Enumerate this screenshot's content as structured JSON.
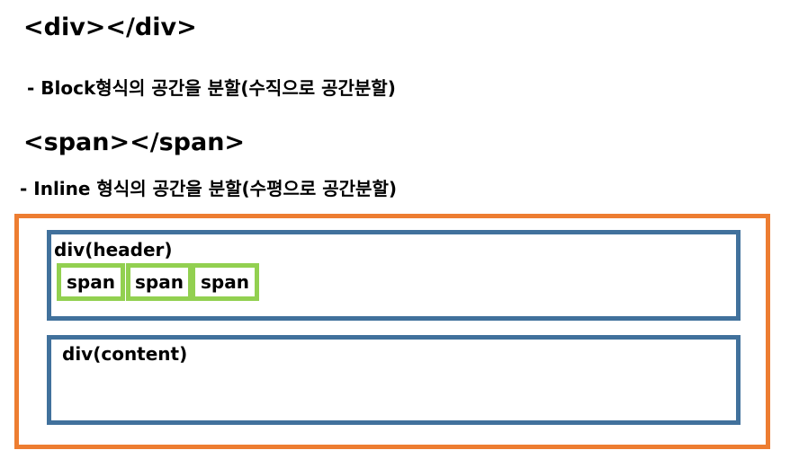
{
  "headings": {
    "div_tag": "<div></div>",
    "div_desc": "- Block형식의 공간을 분할(수직으로 공간분할)",
    "span_tag": "<span></span>",
    "span_desc": "- Inline 형식의 공간을 분할(수평으로 공간분할)"
  },
  "diagram": {
    "header_label": "div(header)",
    "content_label": "div(content)",
    "spans": [
      "span",
      "span",
      "span"
    ]
  },
  "colors": {
    "outer_border": "#ed7d31",
    "div_border": "#41719c",
    "span_border": "#92d050"
  }
}
